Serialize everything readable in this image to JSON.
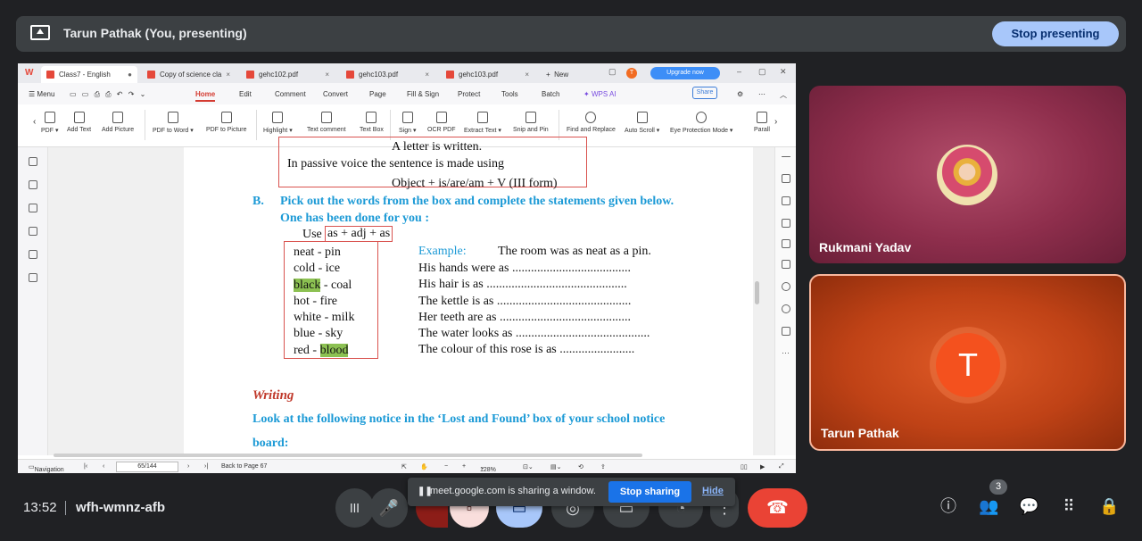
{
  "top_bar": {
    "presenter_title": "Tarun Pathak (You, presenting)",
    "stop_presenting_label": "Stop presenting"
  },
  "wps": {
    "tabs": [
      "Class7 - English",
      "Copy of science cla",
      "gehc102.pdf",
      "gehc103.pdf",
      "gehc103.pdf"
    ],
    "new_tab_label": "New",
    "avatar_letter": "T",
    "upgrade_label": "Upgrade now",
    "menu_label": "Menu",
    "ribbon_tabs": [
      "Home",
      "Edit",
      "Comment",
      "Convert",
      "Page",
      "Fill & Sign",
      "Protect",
      "Tools",
      "Batch",
      "WPS AI"
    ],
    "share_label": "Share",
    "tools": [
      "PDF",
      "Add Text",
      "Add Picture",
      "PDF to Word",
      "PDF to Picture",
      "Highlight",
      "Text comment",
      "Text Box",
      "Sign",
      "OCR PDF",
      "Extract Text",
      "Snip and Pin",
      "Find and Replace",
      "Auto Scroll",
      "Eye Protection Mode",
      "Parall"
    ],
    "status": {
      "navigation": "Navigation",
      "page": "65/144",
      "back_to": "Back to Page 67",
      "zoom": "128%"
    }
  },
  "document": {
    "top_partial": "A letter is written.",
    "passive_line": "In passive voice the sentence is made using",
    "formula": "Object + is/are/am + V (III form)",
    "section_letter": "B.",
    "section_heading_1": "Pick out the words from the box and complete the statements given below.",
    "section_heading_2": "One has been done for you :",
    "use_label": "Use",
    "use_box": "as + adj + as",
    "word_pairs": [
      {
        "a": "neat",
        "b": "pin"
      },
      {
        "a": "cold",
        "b": "ice"
      },
      {
        "a": "black",
        "b": "coal"
      },
      {
        "a": "hot",
        "b": "fire"
      },
      {
        "a": "white",
        "b": "milk"
      },
      {
        "a": "blue",
        "b": "sky"
      },
      {
        "a": "red",
        "b": "blood"
      }
    ],
    "example_label": "Example:",
    "example_text": "The room was as neat as a pin.",
    "statements": [
      "His hands were as ......................................",
      "His hair is as .............................................",
      "The kettle is as ...........................................",
      "Her teeth are as ..........................................",
      "The water looks as ...........................................",
      "The colour of this rose is as ........................"
    ],
    "writing_heading": "Writing",
    "notice_line_1": "Look at the following notice in the ‘Lost and Found’ box of your school notice",
    "notice_line_2": "board:"
  },
  "participants": [
    {
      "name": "Rukmani Yadav"
    },
    {
      "name": "Tarun Pathak",
      "initial": "T"
    }
  ],
  "bottom": {
    "time": "13:52",
    "meeting_code": "wfh-wmnz-afb",
    "share_banner_text": "meet.google.com is sharing a window.",
    "stop_sharing_label": "Stop sharing",
    "hide_label": "Hide",
    "people_count": "3"
  },
  "colors": {
    "meet_bg": "#202124",
    "stop_presenting_bg": "#a8c7fa",
    "end_call": "#ea4335",
    "heading_blue": "#1c9ad6",
    "writing_red": "#c0392b",
    "highlight_green": "#8cc152"
  }
}
